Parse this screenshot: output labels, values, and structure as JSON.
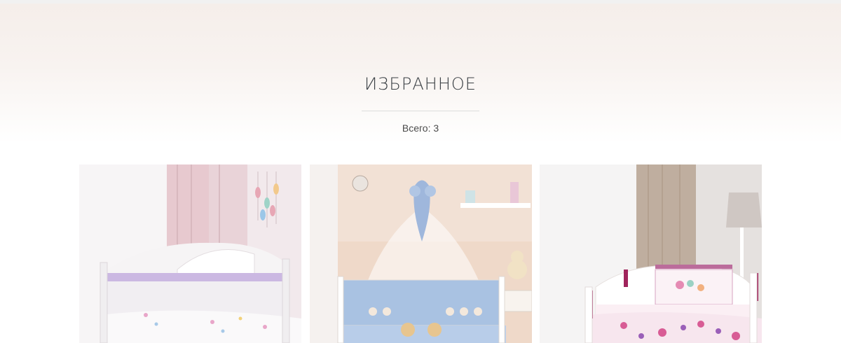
{
  "page": {
    "title": "ИЗБРАННОЕ",
    "count_label": "Всего: 3"
  },
  "products": [
    {
      "image": "crib-white-lilac-photo"
    },
    {
      "image": "crib-blue-canopy-photo"
    },
    {
      "image": "crib-floral-pink-photo"
    }
  ],
  "colors": {
    "title": "#3a3f44",
    "hero_top": "#f5eeea",
    "divider": "#dcdcdc"
  }
}
